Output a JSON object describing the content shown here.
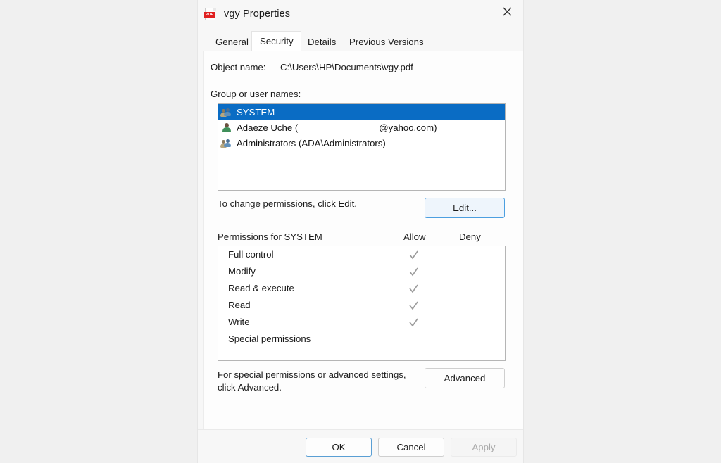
{
  "window": {
    "title": "vgy Properties",
    "file_icon": "pdf-file-icon",
    "pdf_badge": "PDF",
    "close_icon": "close-icon"
  },
  "tabs": [
    {
      "label": "General",
      "selected": false
    },
    {
      "label": "Security",
      "selected": true
    },
    {
      "label": "Details",
      "selected": false
    },
    {
      "label": "Previous Versions",
      "selected": false
    }
  ],
  "security": {
    "object_name_label": "Object name:",
    "object_name_value": "C:\\Users\\HP\\Documents\\vgy.pdf",
    "group_or_user_names_label": "Group or user names:",
    "users": [
      {
        "name": "SYSTEM",
        "icon": "group-icon",
        "selected": true
      },
      {
        "name_prefix": "Adaeze Uche (",
        "name_suffix": "@yahoo.com)",
        "redacted": true,
        "icon": "user-icon",
        "selected": false
      },
      {
        "name": "Administrators (ADA\\Administrators)",
        "icon": "group-icon",
        "selected": false
      }
    ],
    "edit_hint": "To change permissions, click Edit.",
    "edit_button": "Edit...",
    "permissions_for_label": "Permissions for SYSTEM",
    "allow_column": "Allow",
    "deny_column": "Deny",
    "permissions": [
      {
        "name": "Full control",
        "allow": true,
        "deny": false
      },
      {
        "name": "Modify",
        "allow": true,
        "deny": false
      },
      {
        "name": "Read & execute",
        "allow": true,
        "deny": false
      },
      {
        "name": "Read",
        "allow": true,
        "deny": false
      },
      {
        "name": "Write",
        "allow": true,
        "deny": false
      },
      {
        "name": "Special permissions",
        "allow": false,
        "deny": false
      }
    ],
    "advanced_hint": "For special permissions or advanced settings,\nclick Advanced.",
    "advanced_button": "Advanced"
  },
  "footer": {
    "ok": "OK",
    "cancel": "Cancel",
    "apply": "Apply",
    "apply_disabled": true
  },
  "colors": {
    "selection_blue": "#0a6cc4",
    "focus_blue": "#4c9fe0",
    "pdf_red": "#e02020",
    "checkmark_gray": "#9a9a9a",
    "dialog_bg": "#f7f7f7",
    "panel_bg": "#fdfdfd"
  }
}
